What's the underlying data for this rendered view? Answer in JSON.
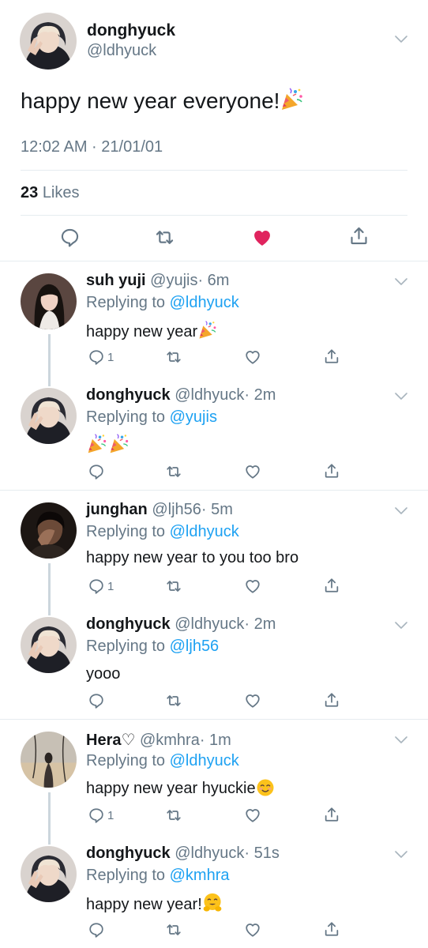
{
  "main_tweet": {
    "name": "donghyuck",
    "handle": "@ldhyuck",
    "text": "happy new year everyone!",
    "emoji": "party-popper",
    "timestamp": "12:02 AM · 21/01/01",
    "likes_count": "23",
    "likes_label": "Likes",
    "liked": true
  },
  "replies": [
    {
      "name": "suh yuji",
      "handle": "@yujis",
      "time": "· 6m",
      "replying_label": "Replying to",
      "replying_to": "@ldhyuck",
      "text": "happy new year",
      "emoji": "party-popper",
      "reply_count": "1"
    },
    {
      "name": "donghyuck",
      "handle": "@ldhyuck",
      "time": "· 2m",
      "replying_label": "Replying to",
      "replying_to": "@yujis",
      "text": "",
      "emoji": "party-popper x2",
      "reply_count": ""
    },
    {
      "name": "junghan",
      "handle": "@ljh56",
      "time": "· 5m",
      "replying_label": "Replying to",
      "replying_to": "@ldhyuck",
      "text": "happy new year to you too bro",
      "reply_count": "1"
    },
    {
      "name": "donghyuck",
      "handle": "@ldhyuck",
      "time": "· 2m",
      "replying_label": "Replying to",
      "replying_to": "@ljh56",
      "text": "yooo",
      "reply_count": ""
    },
    {
      "name": "Hera♡",
      "handle": "@kmhra",
      "time": "· 1m",
      "replying_label": "Replying to",
      "replying_to": "@ldhyuck",
      "text": "happy new year hyuckie",
      "emoji": "smiling-face",
      "reply_count": "1"
    },
    {
      "name": "donghyuck",
      "handle": "@ldhyuck",
      "time": "· 51s",
      "replying_label": "Replying to",
      "replying_to": "@kmhra",
      "text": "happy new year!",
      "emoji": "hugging-face",
      "reply_count": ""
    }
  ],
  "colors": {
    "text": "#14171a",
    "secondary": "#657786",
    "link": "#1da1f2",
    "like_active": "#e0245e",
    "divider": "#e6ecf0"
  }
}
